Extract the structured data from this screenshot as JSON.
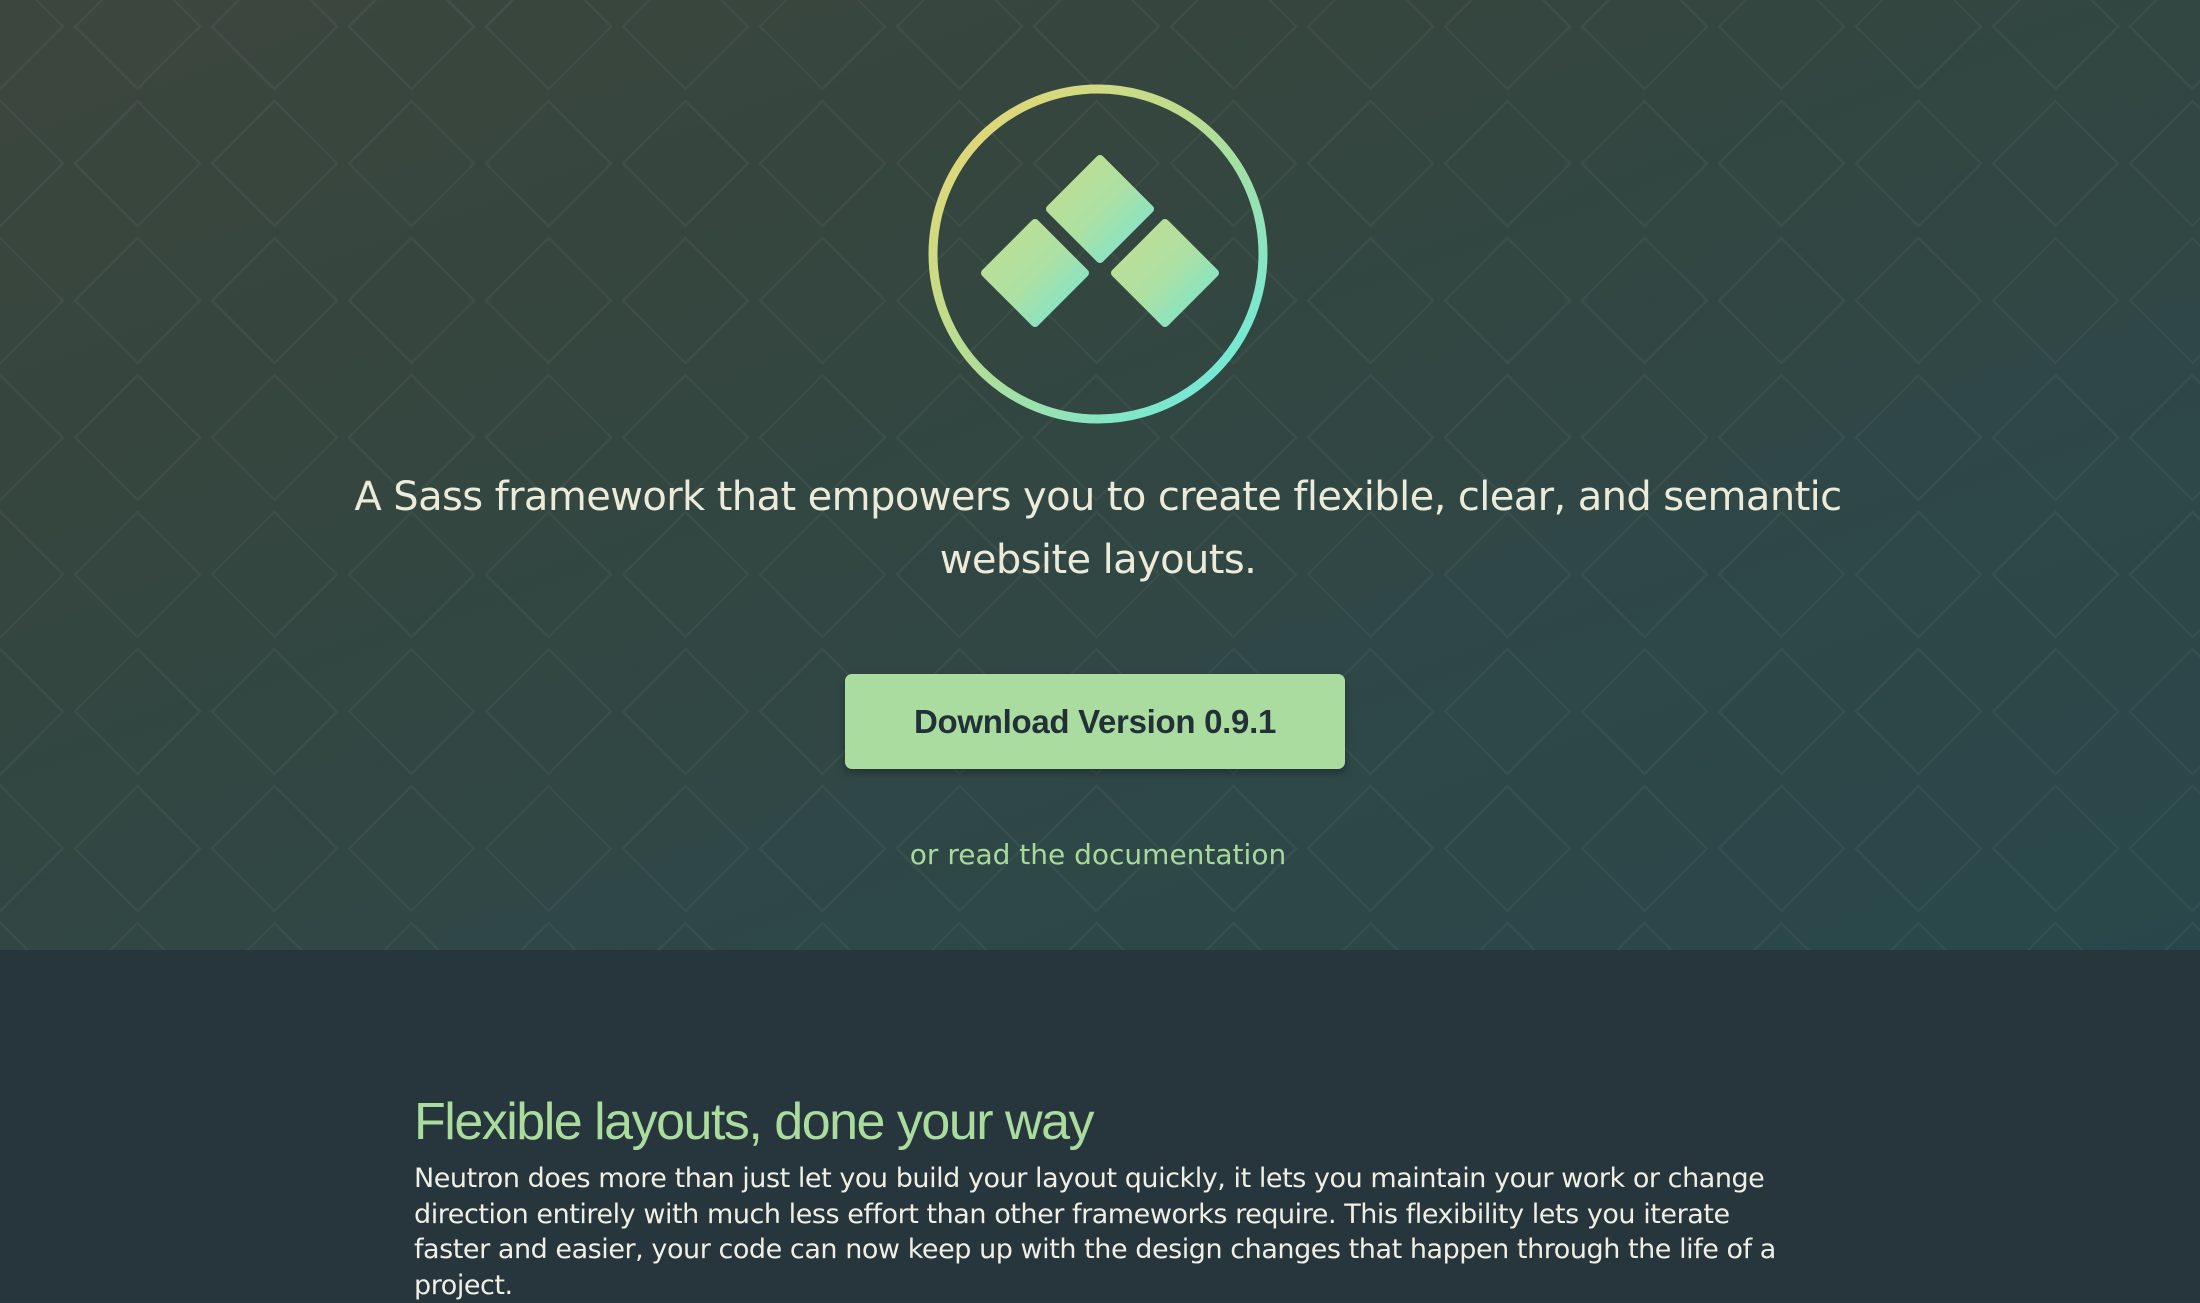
{
  "colors": {
    "hero_background_start": "#3b463e",
    "hero_background_end": "#29474b",
    "section_background": "#27363d",
    "accent_green": "#abdc9f",
    "accent_teal": "#6ee8de",
    "accent_yellow": "#e7d77a",
    "text_light": "#ecebd9",
    "button_text": "#223138"
  },
  "hero": {
    "logo_icon": "neutron-logo-icon",
    "tagline": "A Sass framework that empowers you to create flexible, clear, and semantic website layouts.",
    "download_button_label": "Download Version 0.9.1",
    "docs_link_label": "or read the documentation"
  },
  "features": {
    "title": "Flexible layouts, done your way",
    "body": "Neutron does more than just let you build your layout quickly, it lets you maintain your work or change direction entirely with much less effort than other frameworks require. This flexibility lets you iterate faster and easier, your code can now keep up with the design changes that happen through the life of a project."
  }
}
